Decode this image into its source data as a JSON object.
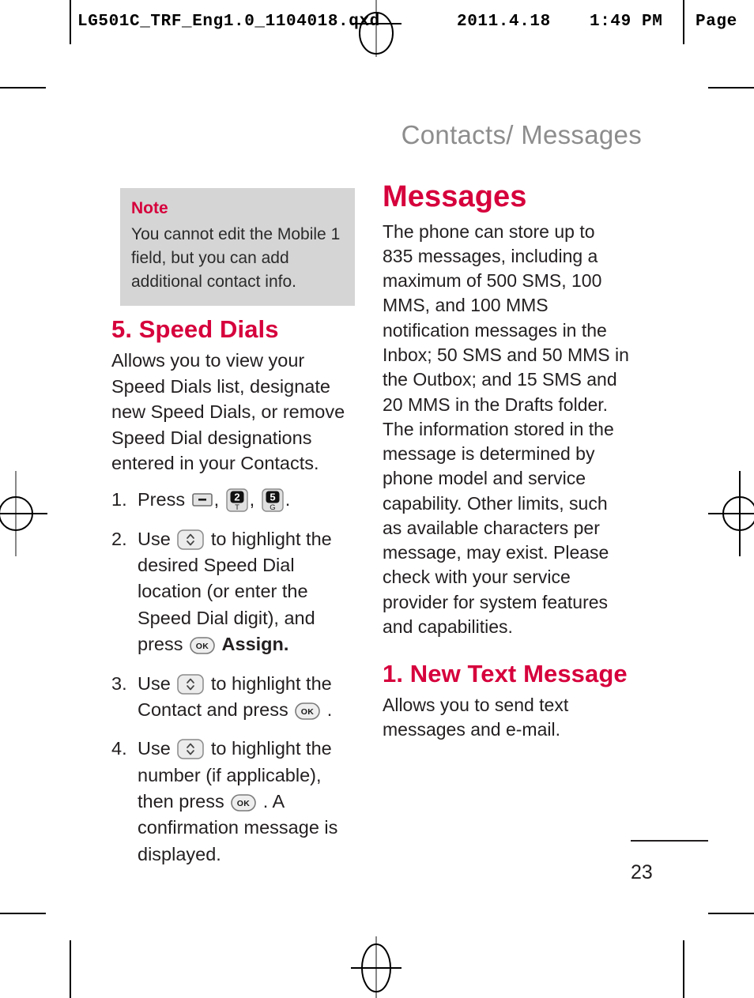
{
  "slug": {
    "file": "LG501C_TRF_Eng1.0_1104018.qxd",
    "date": "2011.4.18",
    "time": "1:49 PM",
    "page_label": "Page"
  },
  "colors": {
    "accent": "#d6003c",
    "running_head": "#8d8d8d",
    "note_bg": "#d5d5d5",
    "body_text": "#231f20"
  },
  "running_head": "Contacts/ Messages",
  "left_column": {
    "note": {
      "title": "Note",
      "body": "You cannot edit the Mobile 1 field, but you can add additional contact info."
    },
    "section": {
      "heading": "5. Speed Dials",
      "intro": "Allows you to view your Speed Dials list, designate new Speed Dials, or remove Speed Dial designations entered in your Contacts."
    },
    "steps": [
      {
        "num": "1.",
        "parts": [
          {
            "type": "text",
            "value": "Press "
          },
          {
            "type": "key",
            "key": "menu"
          },
          {
            "type": "text",
            "value": ", "
          },
          {
            "type": "key",
            "key": "2T"
          },
          {
            "type": "text",
            "value": ", "
          },
          {
            "type": "key",
            "key": "5G"
          },
          {
            "type": "text",
            "value": "."
          }
        ]
      },
      {
        "num": "2.",
        "parts": [
          {
            "type": "text",
            "value": "Use "
          },
          {
            "type": "key",
            "key": "nav"
          },
          {
            "type": "text",
            "value": " to highlight the desired Speed Dial location (or enter the Speed Dial digit), and press "
          },
          {
            "type": "key",
            "key": "ok"
          },
          {
            "type": "text",
            "value": " "
          },
          {
            "type": "bold",
            "value": "Assign."
          }
        ]
      },
      {
        "num": "3.",
        "parts": [
          {
            "type": "text",
            "value": "Use "
          },
          {
            "type": "key",
            "key": "nav"
          },
          {
            "type": "text",
            "value": " to highlight the Contact and press "
          },
          {
            "type": "key",
            "key": "ok"
          },
          {
            "type": "text",
            "value": " ."
          }
        ]
      },
      {
        "num": "4.",
        "parts": [
          {
            "type": "text",
            "value": "Use "
          },
          {
            "type": "key",
            "key": "nav"
          },
          {
            "type": "text",
            "value": " to highlight the number (if applicable), then press "
          },
          {
            "type": "key",
            "key": "ok"
          },
          {
            "type": "text",
            "value": " . A confirmation message is displayed."
          }
        ]
      }
    ]
  },
  "right_column": {
    "heading": "Messages",
    "paragraph": "The phone can store up to 835 messages, including a maximum of 500 SMS, 100 MMS, and 100 MMS notification messages in the Inbox; 50 SMS and 50 MMS in the Outbox; and 15 SMS and 20 MMS in the Drafts folder. The information stored in the message is determined by phone model and service capability. Other limits, such as available characters per message, may exist. Please check with your service provider for system features and capabilities.",
    "subsection": {
      "heading": "1. New Text Message",
      "body": "Allows you to send text messages and e-mail."
    }
  },
  "folio": "23",
  "key_glyphs": {
    "menu": "menu-key-icon",
    "2T": "keypad-2-t-icon",
    "5G": "keypad-5-g-icon",
    "nav": "navigation-updown-key-icon",
    "ok": "ok-key-icon"
  }
}
